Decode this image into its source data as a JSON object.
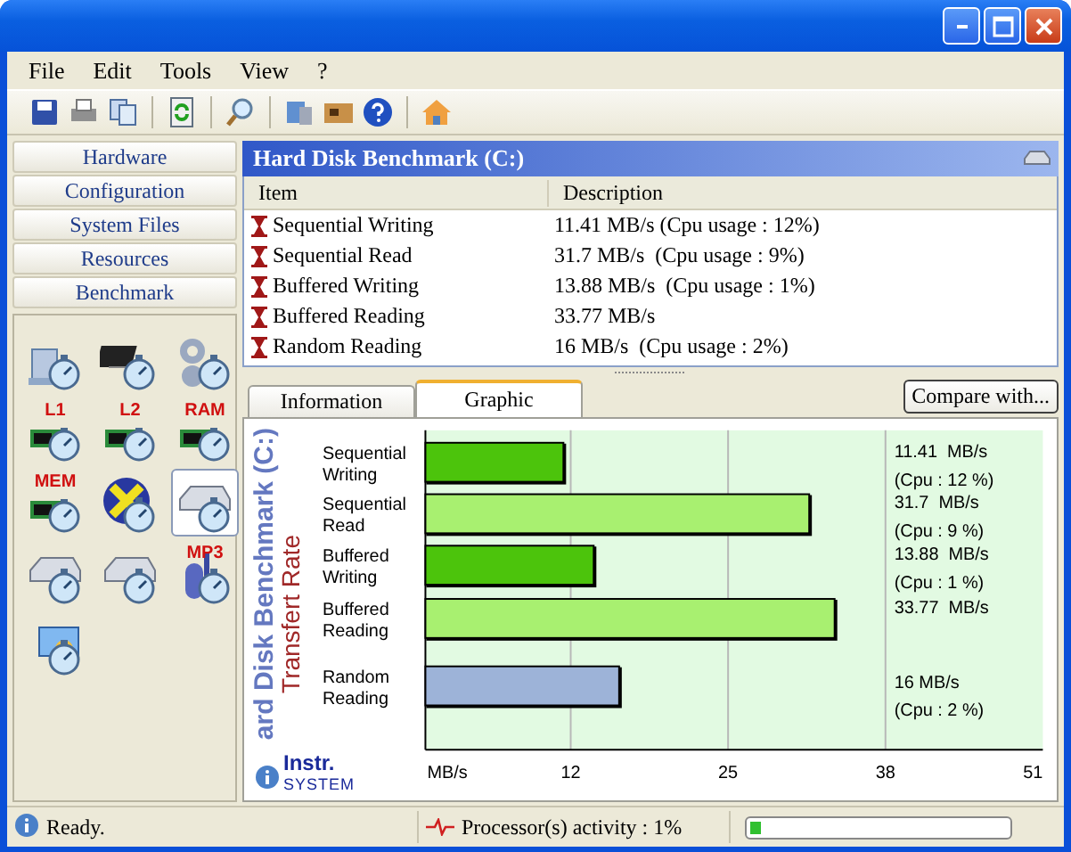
{
  "menu": [
    "File",
    "Edit",
    "Tools",
    "View",
    "?"
  ],
  "sidebar": {
    "sections": [
      "Hardware",
      "Configuration",
      "System Files",
      "Resources",
      "Benchmark"
    ],
    "tools": [
      {
        "selected": false
      },
      {
        "selected": false
      },
      {
        "selected": false
      },
      {
        "label": "L1",
        "selected": false
      },
      {
        "label": "L2",
        "selected": false
      },
      {
        "label": "RAM",
        "selected": false
      },
      {
        "label": "MEM",
        "selected": false
      },
      {
        "selected": false
      },
      {
        "selected": true
      },
      {
        "selected": false
      },
      {
        "selected": false
      },
      {
        "label": "MP3",
        "selected": false
      },
      {
        "selected": false
      }
    ]
  },
  "panel": {
    "title": "Hard Disk Benchmark (C:)",
    "columns": [
      "Item",
      "Description"
    ],
    "rows": [
      {
        "item": "Sequential Writing",
        "description": "11.41 MB/s (Cpu usage : 12%)"
      },
      {
        "item": "Sequential Read",
        "description": "31.7 MB/s  (Cpu usage : 9%)"
      },
      {
        "item": "Buffered Writing",
        "description": "13.88 MB/s  (Cpu usage : 1%)"
      },
      {
        "item": "Buffered Reading",
        "description": "33.77 MB/s"
      },
      {
        "item": "Random Reading",
        "description": "16 MB/s  (Cpu usage : 2%)"
      }
    ]
  },
  "tabs": [
    {
      "label": "Information",
      "selected": false
    },
    {
      "label": "Graphic",
      "selected": true
    }
  ],
  "compare_button": "Compare with...",
  "graphic": {
    "title": "ard Disk Benchmark (C:)",
    "subtitle": "Transfert Rate",
    "logo": {
      "name": "Instr.",
      "tagline": "SYSTEM"
    },
    "readings": [
      {
        "rate": "11.41  MB/s",
        "cpu": "(Cpu : 12 %)"
      },
      {
        "rate": "31.7  MB/s",
        "cpu": "(Cpu : 9 %)"
      },
      {
        "rate": "13.88  MB/s",
        "cpu": "(Cpu : 1 %)"
      },
      {
        "rate": "33.77  MB/s"
      },
      {
        "rate": "16 MB/s",
        "cpu": "(Cpu : 2 %)"
      }
    ],
    "chart_data": {
      "type": "bar",
      "orientation": "horizontal",
      "categories": [
        "Sequential Writing",
        "Sequential Read",
        "Buffered Writing",
        "Buffered Reading",
        "Random Reading"
      ],
      "values": [
        11.4,
        31.7,
        13.9,
        33.8,
        16
      ],
      "colors": [
        "#4cc40c",
        "#a8f070",
        "#4cc40c",
        "#a8f070",
        "#9db3d8"
      ],
      "grid": true,
      "xlabel": "MB/s",
      "xlim": [
        0,
        51
      ],
      "xticks": [
        12,
        25,
        38,
        51
      ]
    }
  },
  "status_bar": {
    "message": "Ready.",
    "activity": "Processor(s) activity : 1%",
    "level": 0.04
  }
}
